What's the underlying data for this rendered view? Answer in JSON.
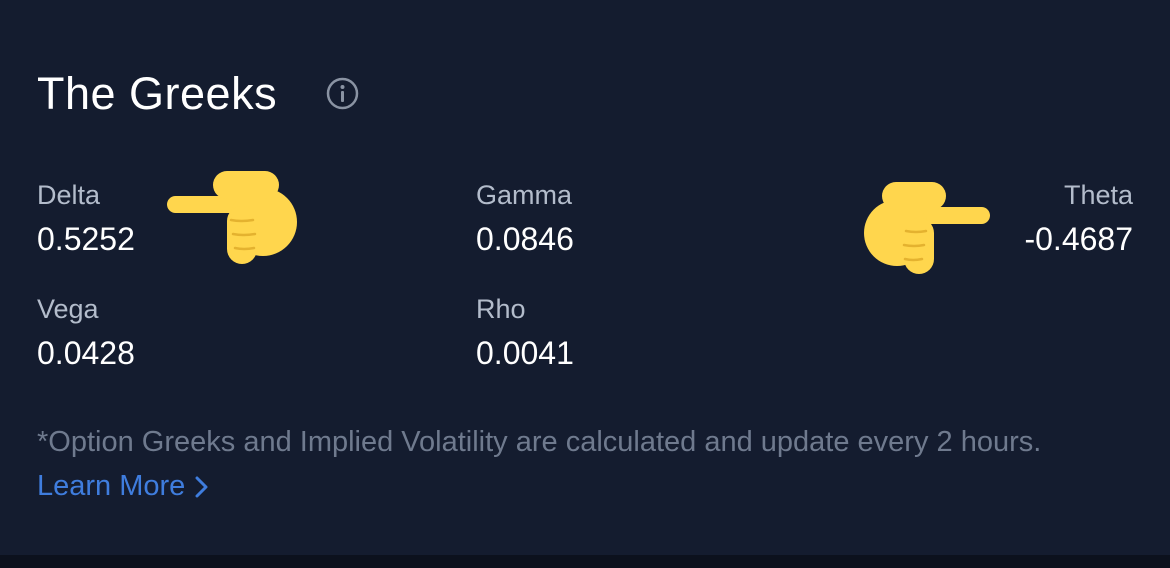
{
  "panel": {
    "title": "The Greeks",
    "info_icon": "info-circle-icon"
  },
  "greeks": {
    "delta": {
      "label": "Delta",
      "value": "0.5252"
    },
    "gamma": {
      "label": "Gamma",
      "value": "0.0846"
    },
    "theta": {
      "label": "Theta",
      "value": "-0.4687"
    },
    "vega": {
      "label": "Vega",
      "value": "0.0428"
    },
    "rho": {
      "label": "Rho",
      "value": "0.0041"
    }
  },
  "annotations": {
    "right_pointer_icon": "backhand-index-pointing-right-emoji",
    "left_pointer_icon": "backhand-index-pointing-left-emoji",
    "emoji_color": "#ffd64d"
  },
  "footnote": {
    "text": "*Option Greeks and Implied Volatility are calculated and update every 2 hours.",
    "link_label": "Learn More",
    "link_icon": "chevron-right-icon",
    "link_color": "#3f7dde"
  },
  "colors": {
    "background": "#141c2f",
    "label": "#b3bccb",
    "value": "#ffffff",
    "footnote": "#6f7a8e"
  }
}
